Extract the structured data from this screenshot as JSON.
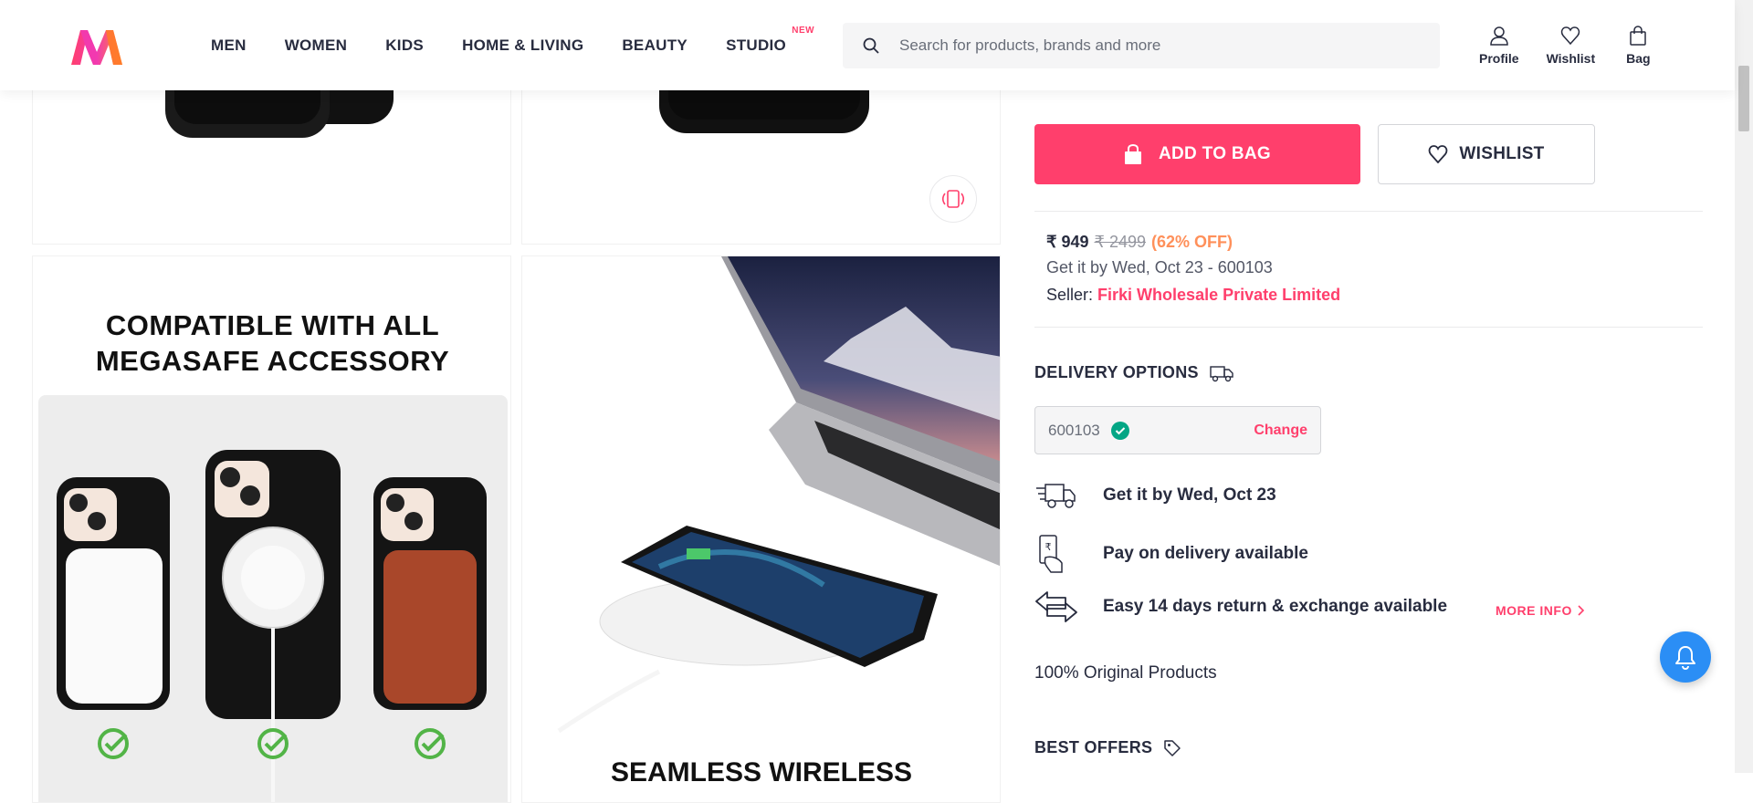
{
  "header": {
    "nav": [
      {
        "label": "MEN"
      },
      {
        "label": "WOMEN"
      },
      {
        "label": "KIDS"
      },
      {
        "label": "HOME & LIVING"
      },
      {
        "label": "BEAUTY"
      },
      {
        "label": "STUDIO",
        "badge": "NEW"
      }
    ],
    "search_placeholder": "Search for products, brands and more",
    "actions": {
      "profile": "Profile",
      "wishlist": "Wishlist",
      "bag": "Bag"
    }
  },
  "gallery": {
    "compat_title": "COMPATIBLE WITH ALL MEGASAFE ACCESSORY",
    "seamless_title": "SEAMLESS WIRELESS"
  },
  "product": {
    "add_to_bag": "ADD TO BAG",
    "wishlist": "WISHLIST",
    "price": "₹ 949",
    "mrp": "₹ 2499",
    "discount": "(62% OFF)",
    "delivery_line": "Get it by Wed, Oct 23 - 600103",
    "seller_label": "Seller:",
    "seller_name": "Firki Wholesale Private Limited"
  },
  "delivery": {
    "title": "DELIVERY OPTIONS",
    "pincode": "600103",
    "change": "Change",
    "options": [
      {
        "icon": "delivery-truck-icon",
        "text": "Get it by Wed, Oct 23"
      },
      {
        "icon": "cash-on-delivery-icon",
        "text": "Pay on delivery available"
      },
      {
        "icon": "return-exchange-icon",
        "text": "Easy 14 days return & exchange available"
      }
    ],
    "more_info": "MORE INFO",
    "original": "100% Original Products"
  },
  "offers": {
    "title": "BEST OFFERS"
  },
  "colors": {
    "brand": "#ff3f6c",
    "discount": "#ff905a",
    "check": "#03a685",
    "bell": "#2b8ef5"
  }
}
